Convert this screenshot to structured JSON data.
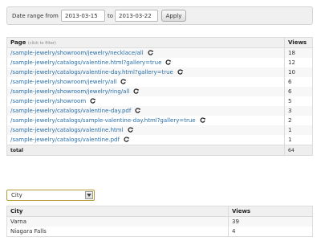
{
  "daterange": {
    "from_label": "Date range from",
    "from_value": "2013-03-15",
    "to_label": "to",
    "to_value": "2013-03-22",
    "apply_label": "Apply"
  },
  "pages_table": {
    "page_header": "Page",
    "page_header_hint": "(click to filter)",
    "views_header": "Views",
    "rows": [
      {
        "page": "/sample-jewelry/showroom/jewelry/necklace/all",
        "views": "18"
      },
      {
        "page": "/sample-jewelry/catalogs/valentine.html?gallery=true",
        "views": "12"
      },
      {
        "page": "/sample-jewelry/catalogs/valentine-day.html?gallery=true",
        "views": "10"
      },
      {
        "page": "/sample-jewelry/showroom/jewelry/all",
        "views": "6"
      },
      {
        "page": "/sample-jewelry/showroom/jewelry/ring/all",
        "views": "6"
      },
      {
        "page": "/sample-jewelry/showroom",
        "views": "5"
      },
      {
        "page": "/sample-jewelry/catalogs/valentine-day.pdf",
        "views": "3"
      },
      {
        "page": "/sample-jewelry/catalogs/sample-valentine-day.html?gallery=true",
        "views": "2"
      },
      {
        "page": "/sample-jewelry/catalogs/valentine.html",
        "views": "1"
      },
      {
        "page": "/sample-jewelry/catalogs/valentine.pdf",
        "views": "1"
      }
    ],
    "total_label": "total",
    "total_value": "64"
  },
  "city_select": {
    "selected": "City"
  },
  "cities_table": {
    "city_header": "City",
    "views_header": "Views",
    "rows": [
      {
        "city": "Varna",
        "views": "39"
      },
      {
        "city": "Niagara Falls",
        "views": "4"
      }
    ]
  },
  "colors": {
    "link": "#2a6fa8",
    "select_border": "#b59a3a"
  },
  "icons": {
    "row_action": "refresh-icon",
    "select_arrow": "chevron-down-icon"
  }
}
